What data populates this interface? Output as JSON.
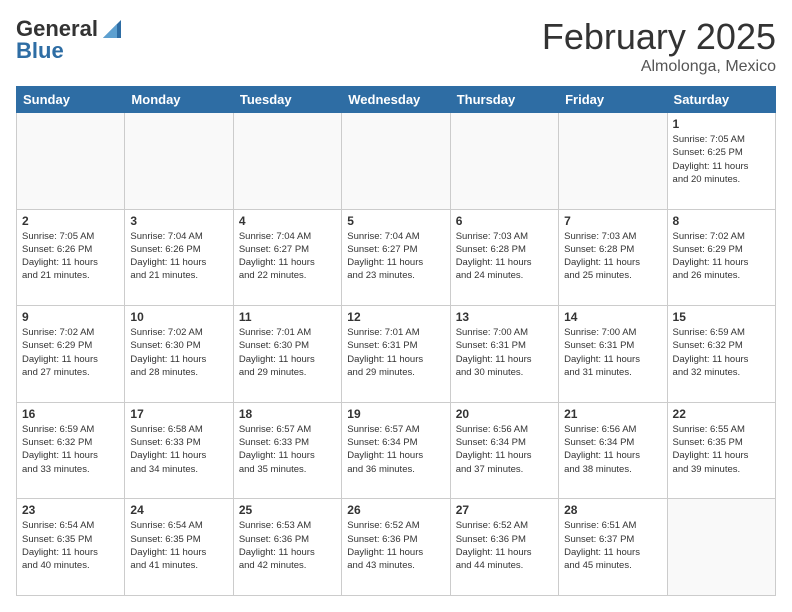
{
  "header": {
    "logo": {
      "general": "General",
      "blue": "Blue"
    },
    "title": "February 2025",
    "location": "Almolonga, Mexico"
  },
  "weekdays": [
    "Sunday",
    "Monday",
    "Tuesday",
    "Wednesday",
    "Thursday",
    "Friday",
    "Saturday"
  ],
  "weeks": [
    [
      {
        "day": "",
        "info": ""
      },
      {
        "day": "",
        "info": ""
      },
      {
        "day": "",
        "info": ""
      },
      {
        "day": "",
        "info": ""
      },
      {
        "day": "",
        "info": ""
      },
      {
        "day": "",
        "info": ""
      },
      {
        "day": "1",
        "info": "Sunrise: 7:05 AM\nSunset: 6:25 PM\nDaylight: 11 hours\nand 20 minutes."
      }
    ],
    [
      {
        "day": "2",
        "info": "Sunrise: 7:05 AM\nSunset: 6:26 PM\nDaylight: 11 hours\nand 21 minutes."
      },
      {
        "day": "3",
        "info": "Sunrise: 7:04 AM\nSunset: 6:26 PM\nDaylight: 11 hours\nand 21 minutes."
      },
      {
        "day": "4",
        "info": "Sunrise: 7:04 AM\nSunset: 6:27 PM\nDaylight: 11 hours\nand 22 minutes."
      },
      {
        "day": "5",
        "info": "Sunrise: 7:04 AM\nSunset: 6:27 PM\nDaylight: 11 hours\nand 23 minutes."
      },
      {
        "day": "6",
        "info": "Sunrise: 7:03 AM\nSunset: 6:28 PM\nDaylight: 11 hours\nand 24 minutes."
      },
      {
        "day": "7",
        "info": "Sunrise: 7:03 AM\nSunset: 6:28 PM\nDaylight: 11 hours\nand 25 minutes."
      },
      {
        "day": "8",
        "info": "Sunrise: 7:02 AM\nSunset: 6:29 PM\nDaylight: 11 hours\nand 26 minutes."
      }
    ],
    [
      {
        "day": "9",
        "info": "Sunrise: 7:02 AM\nSunset: 6:29 PM\nDaylight: 11 hours\nand 27 minutes."
      },
      {
        "day": "10",
        "info": "Sunrise: 7:02 AM\nSunset: 6:30 PM\nDaylight: 11 hours\nand 28 minutes."
      },
      {
        "day": "11",
        "info": "Sunrise: 7:01 AM\nSunset: 6:30 PM\nDaylight: 11 hours\nand 29 minutes."
      },
      {
        "day": "12",
        "info": "Sunrise: 7:01 AM\nSunset: 6:31 PM\nDaylight: 11 hours\nand 29 minutes."
      },
      {
        "day": "13",
        "info": "Sunrise: 7:00 AM\nSunset: 6:31 PM\nDaylight: 11 hours\nand 30 minutes."
      },
      {
        "day": "14",
        "info": "Sunrise: 7:00 AM\nSunset: 6:31 PM\nDaylight: 11 hours\nand 31 minutes."
      },
      {
        "day": "15",
        "info": "Sunrise: 6:59 AM\nSunset: 6:32 PM\nDaylight: 11 hours\nand 32 minutes."
      }
    ],
    [
      {
        "day": "16",
        "info": "Sunrise: 6:59 AM\nSunset: 6:32 PM\nDaylight: 11 hours\nand 33 minutes."
      },
      {
        "day": "17",
        "info": "Sunrise: 6:58 AM\nSunset: 6:33 PM\nDaylight: 11 hours\nand 34 minutes."
      },
      {
        "day": "18",
        "info": "Sunrise: 6:57 AM\nSunset: 6:33 PM\nDaylight: 11 hours\nand 35 minutes."
      },
      {
        "day": "19",
        "info": "Sunrise: 6:57 AM\nSunset: 6:34 PM\nDaylight: 11 hours\nand 36 minutes."
      },
      {
        "day": "20",
        "info": "Sunrise: 6:56 AM\nSunset: 6:34 PM\nDaylight: 11 hours\nand 37 minutes."
      },
      {
        "day": "21",
        "info": "Sunrise: 6:56 AM\nSunset: 6:34 PM\nDaylight: 11 hours\nand 38 minutes."
      },
      {
        "day": "22",
        "info": "Sunrise: 6:55 AM\nSunset: 6:35 PM\nDaylight: 11 hours\nand 39 minutes."
      }
    ],
    [
      {
        "day": "23",
        "info": "Sunrise: 6:54 AM\nSunset: 6:35 PM\nDaylight: 11 hours\nand 40 minutes."
      },
      {
        "day": "24",
        "info": "Sunrise: 6:54 AM\nSunset: 6:35 PM\nDaylight: 11 hours\nand 41 minutes."
      },
      {
        "day": "25",
        "info": "Sunrise: 6:53 AM\nSunset: 6:36 PM\nDaylight: 11 hours\nand 42 minutes."
      },
      {
        "day": "26",
        "info": "Sunrise: 6:52 AM\nSunset: 6:36 PM\nDaylight: 11 hours\nand 43 minutes."
      },
      {
        "day": "27",
        "info": "Sunrise: 6:52 AM\nSunset: 6:36 PM\nDaylight: 11 hours\nand 44 minutes."
      },
      {
        "day": "28",
        "info": "Sunrise: 6:51 AM\nSunset: 6:37 PM\nDaylight: 11 hours\nand 45 minutes."
      },
      {
        "day": "",
        "info": ""
      }
    ]
  ]
}
